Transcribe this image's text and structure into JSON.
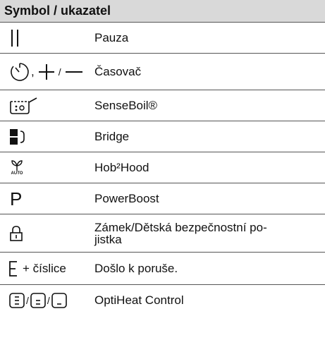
{
  "header": {
    "title": "Symbol / ukazatel"
  },
  "rows": [
    {
      "symbol": "pause-bars",
      "description": "Pauza"
    },
    {
      "symbol": "timer-plus-minus",
      "symbol_text": ",",
      "symbol_sep": "/",
      "description": "Časovač"
    },
    {
      "symbol": "senseboil-pot",
      "description": "SenseBoil®"
    },
    {
      "symbol": "bridge-zones",
      "description": "Bridge"
    },
    {
      "symbol": "fan-auto",
      "symbol_text": "AUTO",
      "description": "Hob²Hood"
    },
    {
      "symbol": "letter-p",
      "symbol_text": "P",
      "description": "PowerBoost"
    },
    {
      "symbol": "padlock",
      "description": "Zámek/Dětská bezpečnostní po-\njistka"
    },
    {
      "symbol": "error-e",
      "symbol_text": "+ číslice",
      "description": "Došlo k poruše."
    },
    {
      "symbol": "optiheat-levels",
      "symbol_sep": "/",
      "description": "OptiHeat Control"
    }
  ]
}
